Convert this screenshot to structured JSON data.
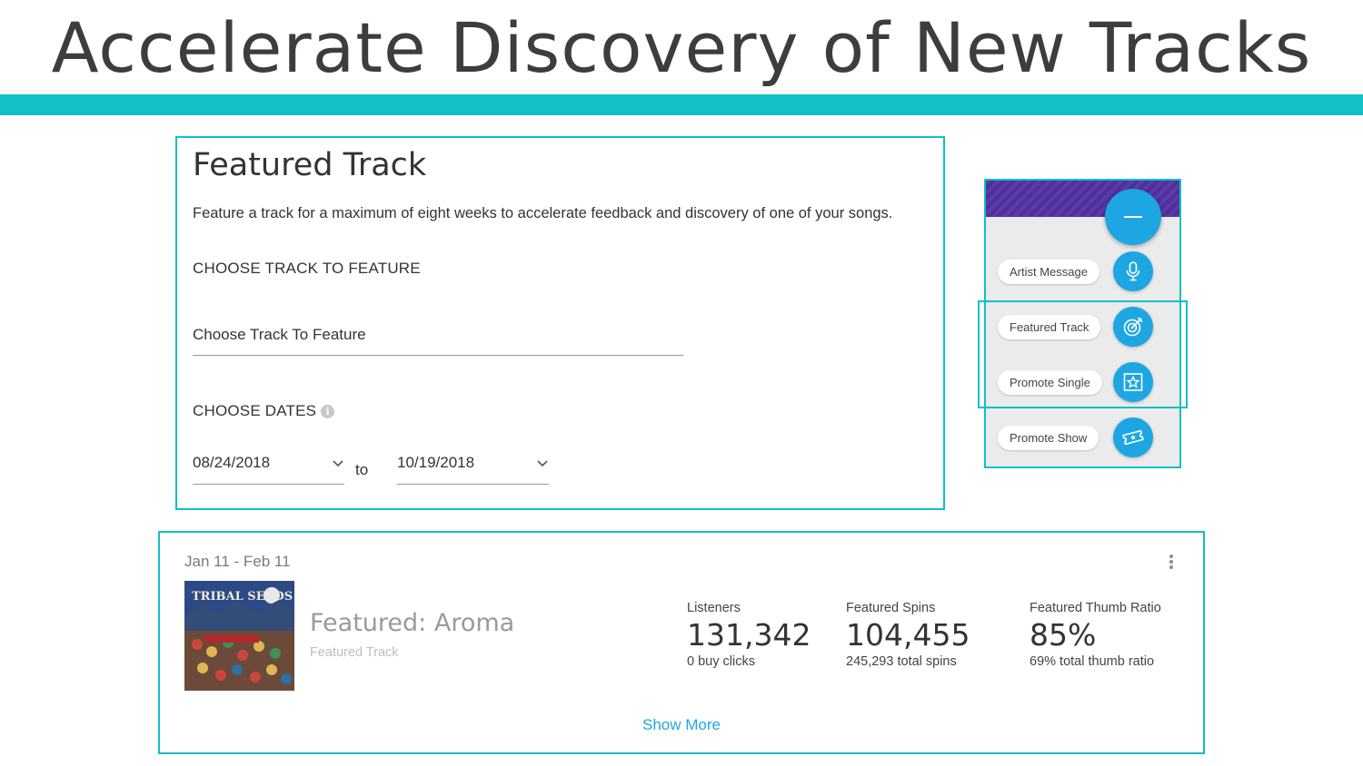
{
  "slide": {
    "title": "Accelerate Discovery of New Tracks"
  },
  "colors": {
    "accent": "#13c0c8",
    "fab_blue": "#1ea6e3",
    "fab_header_purple": "#5a3ba8"
  },
  "form": {
    "title": "Featured Track",
    "description": "Feature a track for a maximum of eight weeks to accelerate feedback and discovery of one of your songs.",
    "choose_track_label": "CHOOSE TRACK TO FEATURE",
    "track_input_value": "Choose Track To Feature",
    "choose_dates_label": "CHOOSE DATES",
    "info_icon": "i",
    "start_date": "08/24/2018",
    "to_word": "to",
    "end_date": "10/19/2018"
  },
  "fab_menu": {
    "main_icon": "minus-icon",
    "items": [
      {
        "label": "Artist Message",
        "icon": "microphone-icon"
      },
      {
        "label": "Featured Track",
        "icon": "target-icon"
      },
      {
        "label": "Promote Single",
        "icon": "star-frame-icon"
      },
      {
        "label": "Promote Show",
        "icon": "ticket-icon"
      }
    ]
  },
  "result": {
    "date_range": "Jan 11 - Feb 11",
    "album_art_text": "TRIBAL SEEDS",
    "title": "Featured: Aroma",
    "subtitle": "Featured Track",
    "stats": [
      {
        "label": "Listeners",
        "value": "131,342",
        "note": "0 buy clicks"
      },
      {
        "label": "Featured Spins",
        "value": "104,455",
        "note": "245,293 total spins"
      },
      {
        "label": "Featured Thumb Ratio",
        "value": "85%",
        "note": "69% total thumb ratio"
      }
    ],
    "show_more": "Show More"
  }
}
